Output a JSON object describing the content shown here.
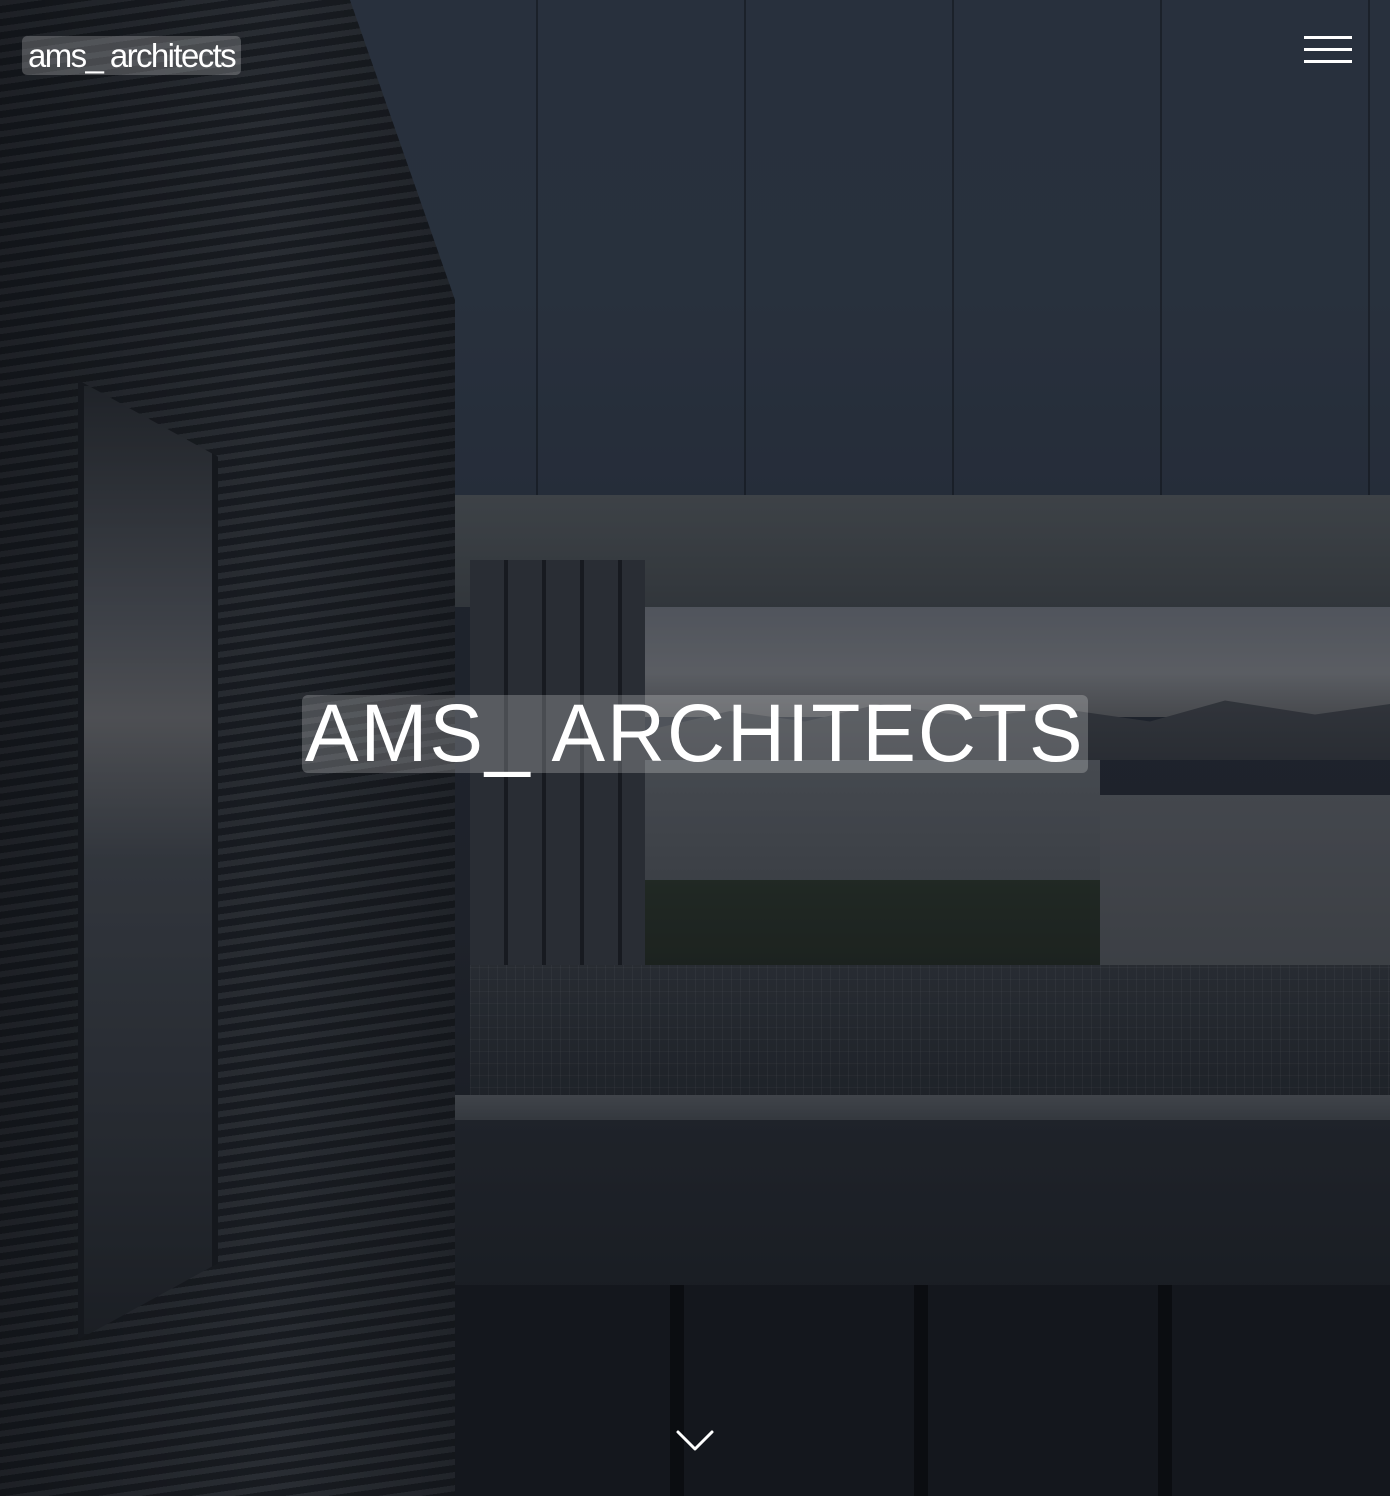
{
  "header": {
    "logo_text": "ams_ architects",
    "menu_icon": "hamburger-menu-icon"
  },
  "hero": {
    "title": "AMS_ ARCHITECTS",
    "scroll_icon": "chevron-down-icon"
  },
  "colors": {
    "text": "#ffffff",
    "label_background": "rgba(255,255,255,0.22)",
    "overlay": "rgba(10,14,20,0.38)"
  }
}
